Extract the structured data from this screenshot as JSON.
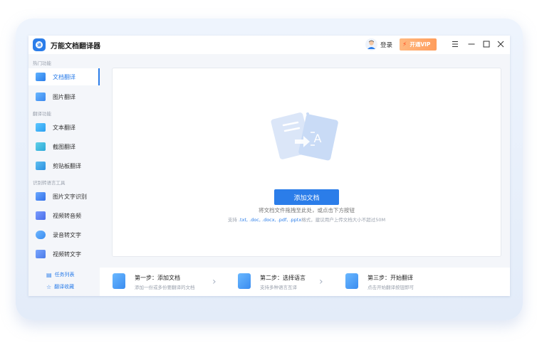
{
  "app": {
    "title": "万能文档翻译器"
  },
  "header": {
    "login_label": "登录",
    "vip_label": "开通VIP",
    "window_controls": [
      "menu-icon",
      "minimize-icon",
      "maximize-icon",
      "close-icon"
    ]
  },
  "sidebar": {
    "sections": [
      {
        "title": "热门功能",
        "items": [
          {
            "label": "文档翻译",
            "icon": "document-icon",
            "active": true
          },
          {
            "label": "图片翻译",
            "icon": "image-icon",
            "active": false
          }
        ]
      },
      {
        "title": "翻译功能",
        "items": [
          {
            "label": "文本翻译",
            "icon": "text-translate-icon"
          },
          {
            "label": "截图翻译",
            "icon": "screenshot-icon"
          },
          {
            "label": "剪贴板翻译",
            "icon": "clipboard-icon"
          }
        ]
      },
      {
        "title": "识别转语言工具",
        "items": [
          {
            "label": "图片文字识别",
            "icon": "ocr-icon"
          },
          {
            "label": "视频转音频",
            "icon": "video-audio-icon"
          },
          {
            "label": "录音转文字",
            "icon": "audio-text-icon"
          },
          {
            "label": "视频转文字",
            "icon": "video-text-icon"
          }
        ]
      }
    ],
    "bottom_links": [
      {
        "label": "任务列表",
        "icon": "task-list-icon"
      },
      {
        "label": "翻译收藏",
        "icon": "star-icon"
      }
    ]
  },
  "main": {
    "drop_hint": "将文档文件拖拽至此处，或点击下方按钮",
    "add_button_label": "添加文档",
    "support_prefix": "支持 ",
    "support_formats": ".txt, .doc, .docx, .pdf, .pptx",
    "support_suffix": "格式，建议用户上传文档大小不超过50M"
  },
  "steps": [
    {
      "title": "第一步：添加文档",
      "subtitle": "添加一份或多份要翻译的文档",
      "icon": "add-document-icon"
    },
    {
      "title": "第二步：选择语言",
      "subtitle": "支持多种语言互译",
      "icon": "language-icon"
    },
    {
      "title": "第三步：开始翻译",
      "subtitle": "点击开始翻译按钮即可",
      "icon": "start-translate-icon"
    }
  ],
  "colors": {
    "accent": "#2b7de9",
    "vip": "#ff9d5c",
    "sidebar_bg": "#f4f6fa"
  }
}
